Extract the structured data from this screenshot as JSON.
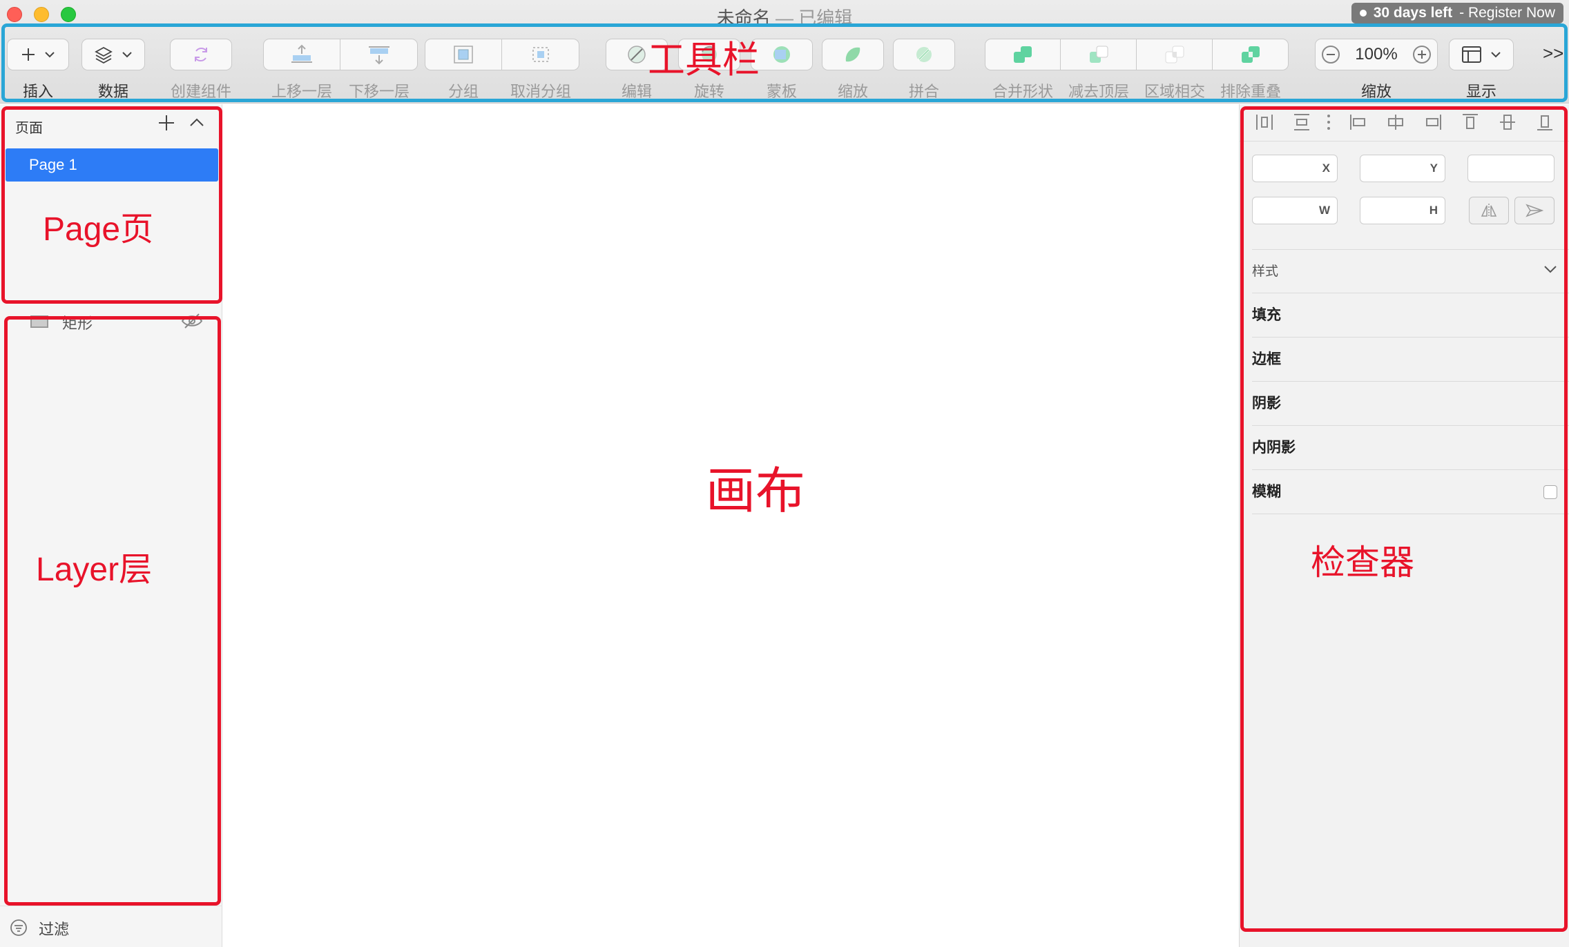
{
  "window": {
    "title": "未命名",
    "edited": "— 已编辑",
    "trial_bold": "30 days left",
    "trial_rest": "- Register Now"
  },
  "toolbar": {
    "insert": "插入",
    "data": "数据",
    "create_symbol": "创建组件",
    "move_up": "上移一层",
    "move_down": "下移一层",
    "group": "分组",
    "ungroup": "取消分组",
    "edit": "编辑",
    "rotate": "旋转",
    "mask": "蒙板",
    "scale": "缩放",
    "flatten": "拼合",
    "union": "合并形状",
    "subtract": "减去顶层",
    "intersect": "区域相交",
    "difference": "排除重叠",
    "zoom_label": "缩放",
    "zoom_value": "100%",
    "view": "显示",
    "overflow": ">>"
  },
  "sidebar": {
    "pages_header": "页面",
    "pages": [
      {
        "label": "Page 1",
        "selected": true
      }
    ],
    "layers": [
      {
        "label": "矩形",
        "hidden": true
      }
    ],
    "filter": "过滤"
  },
  "inspector": {
    "fields": {
      "x": "X",
      "y": "Y",
      "w": "W",
      "h": "H"
    },
    "style_header": "样式",
    "sections": [
      "填充",
      "边框",
      "阴影",
      "内阴影",
      "模糊"
    ]
  },
  "annotations": {
    "toolbar": "工具栏",
    "pages": "Page页",
    "layers": "Layer层",
    "canvas": "画布",
    "inspector": "检查器"
  },
  "colors": {
    "annotation_red": "#e8132a",
    "annotation_blue": "#2aa6d6",
    "selection_blue": "#2d7cf6",
    "boolean_green": "#5fd3a0"
  }
}
